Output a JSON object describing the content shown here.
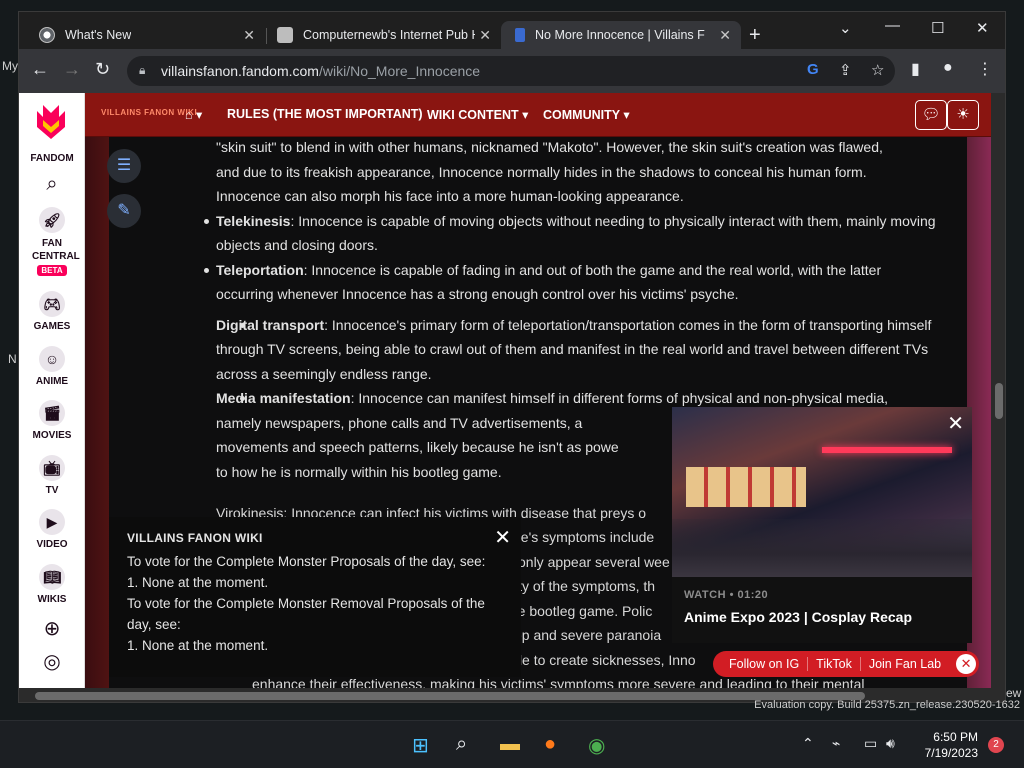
{
  "browser": {
    "tabs": [
      {
        "title": "What's New",
        "active": false
      },
      {
        "title": "Computernewb's Internet Pub Hub",
        "active": false
      },
      {
        "title": "No More Innocence | Villains Fanon Wiki",
        "active": true
      }
    ],
    "url_domain": "villainsfanon.fandom.com",
    "url_path": "/wiki/No_More_Innocence"
  },
  "rail": {
    "brand": "FANDOM",
    "items": [
      {
        "label": "FAN CENTRAL",
        "badge": "BETA",
        "icon": "rocket-icon"
      },
      {
        "label": "GAMES",
        "icon": "gamepad-icon"
      },
      {
        "label": "ANIME",
        "icon": "anime-face-icon"
      },
      {
        "label": "MOVIES",
        "icon": "clapperboard-icon"
      },
      {
        "label": "TV",
        "icon": "tv-icon"
      },
      {
        "label": "VIDEO",
        "icon": "play-icon"
      },
      {
        "label": "WIKIS",
        "icon": "book-icon"
      }
    ]
  },
  "wikibar": {
    "logo_text": "VILLAINS FANON WIKI",
    "nav": [
      "RULES (THE MOST IMPORTANT)",
      "WIKI CONTENT",
      "COMMUNITY"
    ]
  },
  "article": {
    "intro_lines": [
      "\"skin suit\" to blend in with other humans, nicknamed \"Makoto\". However, the skin suit's creation was flawed,",
      "and due to its freakish appearance, Innocence normally hides in the shadows to conceal his human form.",
      "Innocence can also morph his face into a more human-looking appearance."
    ],
    "telekinesis_term": "Telekinesis",
    "telekinesis_text": ": Innocence is capable of moving objects without needing to physically interact with them, mainly moving objects and closing doors.",
    "teleportation_term": "Teleportation",
    "teleportation_text": ": Innocence is capable of fading in and out of both the game and the real world, with the latter occurring whenever Innocence has a strong enough control over his victims' psyche.",
    "digital_term": "Digital transport",
    "digital_text": ": Innocence's primary form of teleportation/transportation comes in the form of transporting himself through TV screens, being able to crawl out of them and manifest in the real world and travel between different TVs across a seemingly endless range.",
    "media_term": "Media manifestation",
    "media_text": ": Innocence can manifest himself in different forms of physical and non-physical media, namely newspapers, phone calls and TV advertisements, a",
    "media_line2": "movements and speech patterns, likely because he isn't as powe",
    "media_line3": "to how he is normally within his bootleg game.",
    "hidden_fragments": [
      "Virokinesis: Innocence can infect his victims with disease that preys o",
      "nce's symptoms include",
      "only appear several wee",
      "sity of the symptoms, th",
      "the bootleg game. Polic",
      "ep and severe paranoia",
      "Disease augmentation: As well as being able to create sicknesses, Inno",
      "enhance their effectiveness, making his victims' symptoms more severe and leading to their mental"
    ]
  },
  "notice": {
    "title": "VILLAINS FANON WIKI",
    "lines": [
      "To vote for the Complete Monster Proposals of the day, see:",
      "1. None at the moment.",
      "To vote for the Complete Monster Removal Proposals of the",
      "day, see:",
      "1. None at the moment."
    ]
  },
  "video": {
    "watch_label": "WATCH • 01:20",
    "title": "Anime Expo 2023 | Cosplay Recap"
  },
  "social": [
    "Follow on IG",
    "TikTok",
    "Join Fan Lab"
  ],
  "eval": "Evaluation copy. Build 25375.zn_release.230520-1632",
  "taskbar": {
    "time": "6:50 PM",
    "date": "7/19/2023",
    "notifications": "2"
  },
  "desktop_fragments": [
    "My",
    "N",
    "ew"
  ],
  "colors": {
    "wikibar": "#8a1511",
    "accent": "#fa005a",
    "social": "#d21d24"
  }
}
